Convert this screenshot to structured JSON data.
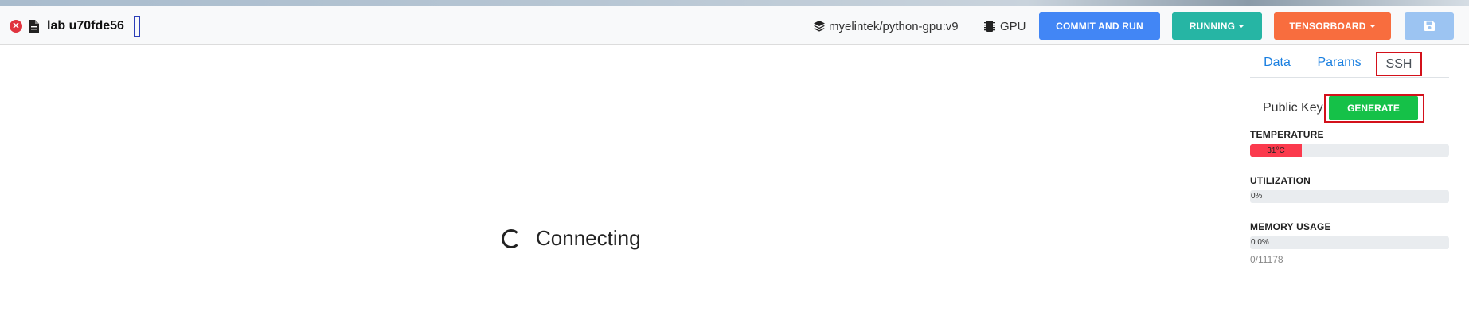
{
  "navbar": {
    "lab_title": "lab u70fde56",
    "image_name": "myelintek/python-gpu:v9",
    "gpu_label": "GPU",
    "commit_label": "COMMIT AND RUN",
    "running_label": "RUNNING",
    "tensorboard_label": "TENSORBOARD",
    "colors": {
      "commit": "#4286f5",
      "running": "#26b5a4",
      "tensorboard": "#f86d3e",
      "save": "#9cc4f2"
    }
  },
  "main": {
    "status_text": "Connecting"
  },
  "sidebar": {
    "tabs": [
      {
        "label": "Data"
      },
      {
        "label": "Params"
      },
      {
        "label": "SSH",
        "active": true
      }
    ],
    "public_key_label": "Public Key",
    "generate_label": "GENERATE",
    "temperature": {
      "label": "TEMPERATURE",
      "value_text": "31°C",
      "fill_fraction": 0.26,
      "color": "#fb3a4d"
    },
    "utilization": {
      "label": "UTILIZATION",
      "value_text": "0%",
      "fill_fraction": 0
    },
    "memory": {
      "label": "MEMORY USAGE",
      "value_text": "0.0%",
      "fill_fraction": 0,
      "detail": "0/11178"
    }
  }
}
